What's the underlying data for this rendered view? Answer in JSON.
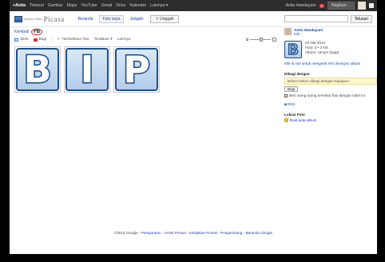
{
  "gbar": {
    "nav": [
      "+Anita",
      "Telusuri",
      "Gambar",
      "Maps",
      "YouTube",
      "Gmail",
      "Drive",
      "Kalender",
      "Lainnya ▾"
    ],
    "active_index": 0,
    "user": "Anita Handayani",
    "badge": "0",
    "share": "Bagikan…"
  },
  "header": {
    "logo_small": "Albums Web",
    "logo_big": "Picasa",
    "tabs": [
      "Beranda",
      "Foto saya",
      "Jelajahi"
    ],
    "upload": "⇧ Unggah",
    "search_button": "Telusuri"
  },
  "crumb": {
    "prefix": "Kembali",
    "album": "FB"
  },
  "toolbar": {
    "items": [
      "Slide",
      "Bagi",
      "Tambahkan foto",
      "Tindakan ▾",
      "Lainnya"
    ]
  },
  "tiles": [
    "B",
    "I",
    "P"
  ],
  "sidebar": {
    "owner": "Anita Handayani",
    "owner_sub": "Info",
    "date": "23 Okt 2013",
    "count": "Foto: 3 • 2 KB",
    "visibility": "Album: Umum (bagi)",
    "share_hint": "Klik di sini untuk mengedit Info deskripsi album",
    "shared_heading": "Dibagi dengan",
    "shared_note": "Belum belum dibagi dengan siapapun",
    "share_button": "Bagi",
    "checkbox_label": "Beri orang-orang tersebut foto dengan label ini",
    "rss": "RSS",
    "location_heading": "Lokasi Foto",
    "location_link": "Buat peta album"
  },
  "footer": {
    "text": "©2014 Google",
    "links": [
      "Persyaratan",
      "Untuk Privasi",
      "Kebijakan Privasi",
      "Pengembang",
      "Beranda Google"
    ]
  }
}
